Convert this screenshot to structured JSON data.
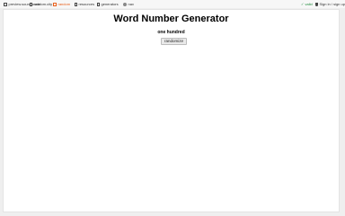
{
  "nav": {
    "items": [
      {
        "label": "preview.sourcecode"
      },
      {
        "label": "random.city"
      },
      {
        "label": "random"
      },
      {
        "label": "resources"
      },
      {
        "label": "generators"
      },
      {
        "label": "nav"
      }
    ],
    "status": "✓ valid",
    "signin": "Sign in / sign up"
  },
  "main": {
    "title": "Word Number Generator",
    "number_words": "one hundred",
    "randomize_label": "randomize"
  },
  "colors": {
    "active": "#e8601c",
    "status_ok": "#1e8a3a"
  }
}
